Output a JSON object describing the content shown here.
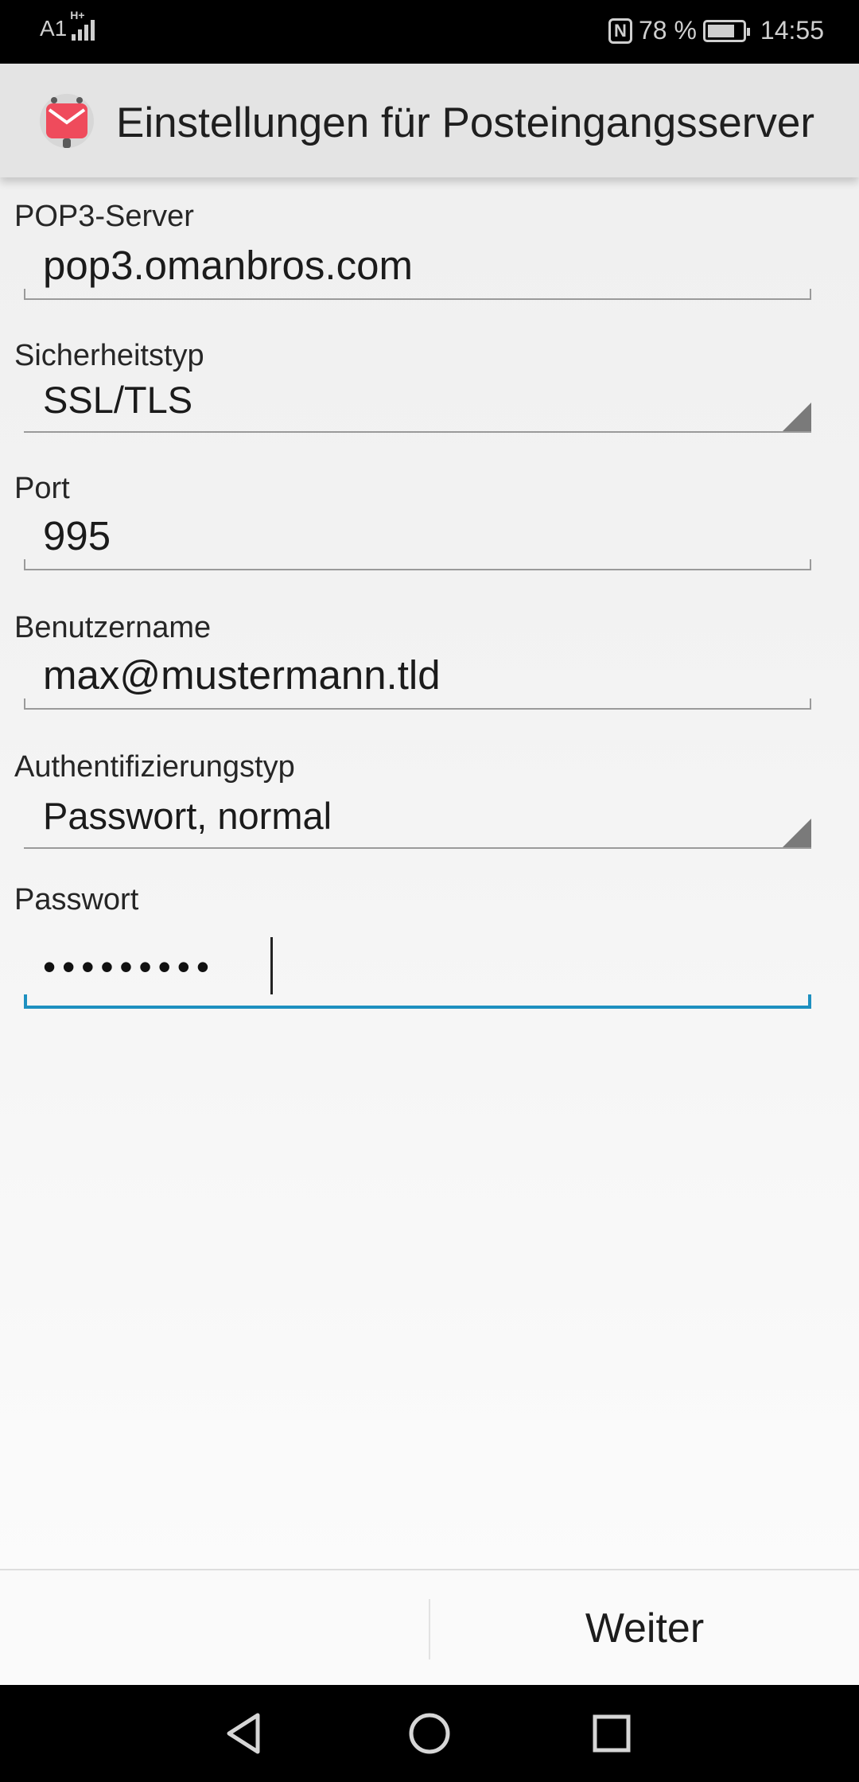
{
  "status_bar": {
    "carrier": "A1",
    "network_type": "H+",
    "battery_percent": "78 %",
    "time": "14:55",
    "icons": [
      "signal-icon",
      "nfc-icon",
      "battery-icon"
    ]
  },
  "app_bar": {
    "icon": "mail-app-icon",
    "title": "Einstellungen für Posteingangsserver"
  },
  "form": {
    "server": {
      "label": "POP3-Server",
      "value": "pop3.omanbros.com"
    },
    "security": {
      "label": "Sicherheitstyp",
      "value": "SSL/TLS"
    },
    "port": {
      "label": "Port",
      "value": "995"
    },
    "username": {
      "label": "Benutzername",
      "value": "max@mustermann.tld"
    },
    "auth": {
      "label": "Authentifizierungstyp",
      "value": "Passwort, normal"
    },
    "password": {
      "label": "Passwort",
      "masked_value": "•••••••••"
    }
  },
  "button_bar": {
    "next_label": "Weiter"
  },
  "nav_bar": {
    "icons": [
      "back-icon",
      "home-icon",
      "recents-icon"
    ]
  },
  "colors": {
    "accent": "#1e90c0",
    "app_icon_red": "#ef4b5c"
  }
}
